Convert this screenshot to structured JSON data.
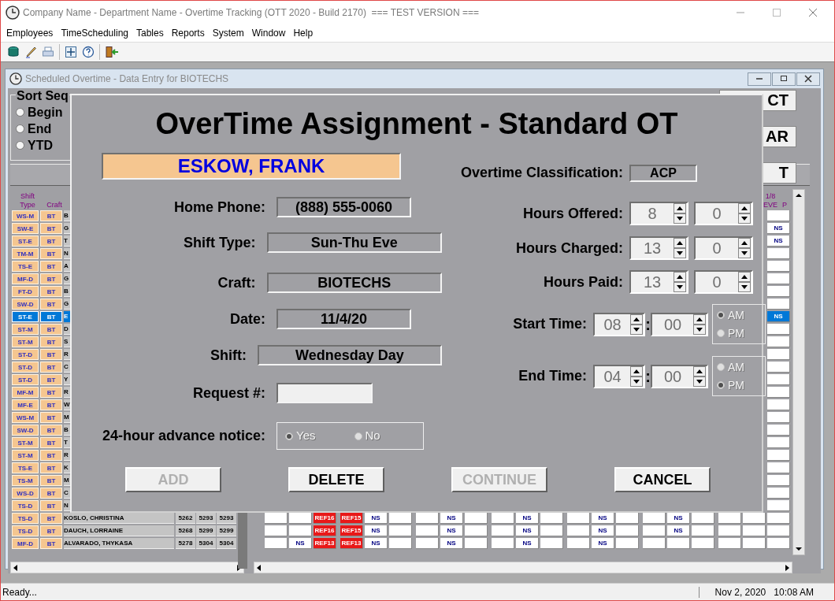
{
  "app_window": {
    "title": "Company Name - Department Name - Overtime Tracking (OTT 2020 - Build 2170)  === TEST VERSION ===",
    "menu": [
      "Employees",
      "TimeScheduling",
      "Tables",
      "Reports",
      "System",
      "Window",
      "Help"
    ]
  },
  "child_window": {
    "title": "Scheduled Overtime - Data Entry for BIOTECHS",
    "sort_group": {
      "label": "Sort Seq",
      "options": [
        {
          "label": "Begin",
          "selected": false
        },
        {
          "label": "End",
          "selected": false
        },
        {
          "label": "YTD",
          "selected": false
        }
      ]
    },
    "side_buttons": [
      "CT",
      "AR",
      "T"
    ],
    "grid": {
      "header_shift_type": "Shift Type",
      "header_craft": "Craft",
      "header_column_21": "1/8 EVE",
      "header_column_22": "P",
      "rows": [
        {
          "shift_type": "WS-M",
          "craft": "BT",
          "name": "B",
          "selected": false,
          "cells": [
            {
              "kind": "blank"
            }
          ]
        },
        {
          "shift_type": "SW-E",
          "craft": "BT",
          "name": "G",
          "selected": false,
          "cells": [
            {
              "kind": "ns",
              "text": "NS"
            }
          ]
        },
        {
          "shift_type": "ST-E",
          "craft": "BT",
          "name": "T",
          "selected": false,
          "cells": [
            {
              "kind": "ns",
              "text": "NS"
            }
          ]
        },
        {
          "shift_type": "TM-M",
          "craft": "BT",
          "name": "N",
          "selected": false,
          "cells": [
            {
              "kind": "blank"
            }
          ]
        },
        {
          "shift_type": "TS-E",
          "craft": "BT",
          "name": "A",
          "selected": false,
          "cells": [
            {
              "kind": "blank"
            }
          ]
        },
        {
          "shift_type": "MF-D",
          "craft": "BT",
          "name": "G",
          "selected": false,
          "cells": [
            {
              "kind": "blank"
            }
          ]
        },
        {
          "shift_type": "FT-D",
          "craft": "BT",
          "name": "B",
          "selected": false,
          "cells": [
            {
              "kind": "blank"
            }
          ]
        },
        {
          "shift_type": "SW-D",
          "craft": "BT",
          "name": "G",
          "selected": false,
          "cells": [
            {
              "kind": "blank"
            }
          ]
        },
        {
          "shift_type": "ST-E",
          "craft": "BT",
          "name": "E",
          "selected": true,
          "cells": [
            {
              "kind": "ns",
              "text": "NS"
            }
          ]
        },
        {
          "shift_type": "ST-M",
          "craft": "BT",
          "name": "D",
          "selected": false,
          "cells": [
            {
              "kind": "blank"
            }
          ]
        },
        {
          "shift_type": "ST-M",
          "craft": "BT",
          "name": "S",
          "selected": false,
          "cells": [
            {
              "kind": "blank"
            }
          ]
        },
        {
          "shift_type": "ST-D",
          "craft": "BT",
          "name": "R",
          "selected": false,
          "cells": [
            {
              "kind": "blank"
            }
          ]
        },
        {
          "shift_type": "ST-D",
          "craft": "BT",
          "name": "C",
          "selected": false,
          "cells": [
            {
              "kind": "blank"
            }
          ]
        },
        {
          "shift_type": "ST-D",
          "craft": "BT",
          "name": "Y",
          "selected": false,
          "cells": [
            {
              "kind": "blank"
            }
          ]
        },
        {
          "shift_type": "MF-M",
          "craft": "BT",
          "name": "R",
          "selected": false,
          "cells": [
            {
              "kind": "blank"
            }
          ]
        },
        {
          "shift_type": "MF-E",
          "craft": "BT",
          "name": "W",
          "selected": false,
          "cells": [
            {
              "kind": "blank"
            }
          ]
        },
        {
          "shift_type": "WS-M",
          "craft": "BT",
          "name": "M",
          "selected": false,
          "cells": [
            {
              "kind": "blank"
            }
          ]
        },
        {
          "shift_type": "SW-D",
          "craft": "BT",
          "name": "B",
          "selected": false,
          "cells": [
            {
              "kind": "blank"
            }
          ]
        },
        {
          "shift_type": "ST-M",
          "craft": "BT",
          "name": "T",
          "selected": false,
          "cells": [
            {
              "kind": "blank"
            }
          ]
        },
        {
          "shift_type": "ST-M",
          "craft": "BT",
          "name": "R",
          "selected": false,
          "cells": [
            {
              "kind": "blank"
            }
          ]
        },
        {
          "shift_type": "TS-E",
          "craft": "BT",
          "name": "K",
          "selected": false,
          "cells": [
            {
              "kind": "blank"
            }
          ]
        },
        {
          "shift_type": "TS-M",
          "craft": "BT",
          "name": "M",
          "selected": false,
          "cells": [
            {
              "kind": "blank"
            }
          ]
        },
        {
          "shift_type": "WS-D",
          "craft": "BT",
          "name": "C",
          "selected": false,
          "cells": [
            {
              "kind": "blank"
            }
          ]
        },
        {
          "shift_type": "TS-D",
          "craft": "BT",
          "name": "N",
          "selected": false,
          "cells": [
            {
              "kind": "blank"
            }
          ]
        },
        {
          "shift_type": "TS-D",
          "craft": "BT",
          "name": "KOSLO, CHRISTINA",
          "numbers": [
            "5262",
            "5293",
            "5293"
          ],
          "selected": false,
          "cells": [
            {
              "kind": "blank"
            },
            {
              "kind": "blank"
            },
            {
              "kind": "ref",
              "text": "REF16"
            },
            {
              "kind": "ref",
              "text": "REF15"
            },
            {
              "kind": "ns",
              "text": "NS"
            },
            {
              "kind": "blank"
            },
            {
              "kind": "blank"
            },
            {
              "kind": "ns",
              "text": "NS"
            },
            {
              "kind": "blank"
            },
            {
              "kind": "blank"
            },
            {
              "kind": "ns",
              "text": "NS"
            },
            {
              "kind": "blank"
            },
            {
              "kind": "blank"
            },
            {
              "kind": "ns",
              "text": "NS"
            },
            {
              "kind": "blank"
            },
            {
              "kind": "blank"
            },
            {
              "kind": "ns",
              "text": "NS"
            },
            {
              "kind": "blank"
            },
            {
              "kind": "blank"
            },
            {
              "kind": "blank"
            },
            {
              "kind": "blank"
            }
          ]
        },
        {
          "shift_type": "TS-D",
          "craft": "BT",
          "name": "DAUCH, LORRAINE",
          "numbers": [
            "5268",
            "5299",
            "5299"
          ],
          "selected": false,
          "cells": [
            {
              "kind": "blank"
            },
            {
              "kind": "blank"
            },
            {
              "kind": "ref",
              "text": "REF16"
            },
            {
              "kind": "ref",
              "text": "REF15"
            },
            {
              "kind": "ns",
              "text": "NS"
            },
            {
              "kind": "blank"
            },
            {
              "kind": "blank"
            },
            {
              "kind": "ns",
              "text": "NS"
            },
            {
              "kind": "blank"
            },
            {
              "kind": "blank"
            },
            {
              "kind": "ns",
              "text": "NS"
            },
            {
              "kind": "blank"
            },
            {
              "kind": "blank"
            },
            {
              "kind": "ns",
              "text": "NS"
            },
            {
              "kind": "blank"
            },
            {
              "kind": "blank"
            },
            {
              "kind": "ns",
              "text": "NS"
            },
            {
              "kind": "blank"
            },
            {
              "kind": "blank"
            },
            {
              "kind": "blank"
            },
            {
              "kind": "blank"
            }
          ]
        },
        {
          "shift_type": "MF-D",
          "craft": "BT",
          "name": "ALVARADO, THYKASA",
          "numbers": [
            "5278",
            "5304",
            "5304"
          ],
          "selected": false,
          "cells": [
            {
              "kind": "blank"
            },
            {
              "kind": "ns",
              "text": "NS"
            },
            {
              "kind": "ref",
              "text": "REF13"
            },
            {
              "kind": "ref",
              "text": "REF13"
            },
            {
              "kind": "ns",
              "text": "NS"
            },
            {
              "kind": "blank"
            },
            {
              "kind": "blank"
            },
            {
              "kind": "ns",
              "text": "NS"
            },
            {
              "kind": "blank"
            },
            {
              "kind": "blank"
            },
            {
              "kind": "ns",
              "text": "NS"
            },
            {
              "kind": "blank"
            },
            {
              "kind": "blank"
            },
            {
              "kind": "ns",
              "text": "NS"
            },
            {
              "kind": "blank"
            },
            {
              "kind": "blank"
            },
            {
              "kind": "blank"
            },
            {
              "kind": "blank"
            },
            {
              "kind": "blank"
            },
            {
              "kind": "blank"
            },
            {
              "kind": "blank"
            }
          ]
        }
      ]
    }
  },
  "dialog": {
    "title": "OverTime Assignment - Standard OT",
    "employee": "ESKOW, FRANK",
    "fields": [
      {
        "label": "Home Phone:",
        "value": "(888) 555-0060",
        "kind": "short"
      },
      {
        "label": "Shift Type:",
        "value": "Sun-Thu Eve",
        "kind": "wide"
      },
      {
        "label": "Craft:",
        "value": "BIOTECHS",
        "kind": "wide"
      },
      {
        "label": "Date:",
        "value": "11/4/20",
        "kind": "short"
      },
      {
        "label": "Shift:",
        "value": "Wednesday Day",
        "kind": "widest"
      },
      {
        "label": "Request #:",
        "kind": "input"
      }
    ],
    "advance_notice": {
      "label": "24-hour advance notice:",
      "disabled": true,
      "options": [
        {
          "label": "Yes",
          "selected": true
        },
        {
          "label": "No",
          "selected": false
        }
      ]
    },
    "classification": {
      "label": "Overtime Classification:",
      "value": "ACP"
    },
    "hours": [
      {
        "label": "Hours Offered:",
        "hours": "8",
        "minutes": "0"
      },
      {
        "label": "Hours Charged:",
        "hours": "13",
        "minutes": "0"
      },
      {
        "label": "Hours Paid:",
        "hours": "13",
        "minutes": "0"
      }
    ],
    "times": [
      {
        "label": "Start Time:",
        "hour": "08",
        "separator": ":",
        "minute": "00",
        "options": [
          {
            "label": "AM",
            "selected": true
          },
          {
            "label": "PM",
            "selected": false
          }
        ]
      },
      {
        "label": "End Time:",
        "hour": "04",
        "separator": ":",
        "minute": "00",
        "options": [
          {
            "label": "AM",
            "selected": false
          },
          {
            "label": "PM",
            "selected": true
          }
        ]
      }
    ],
    "buttons": [
      {
        "label": "ADD",
        "disabled": true
      },
      {
        "label": "DELETE",
        "disabled": false
      },
      {
        "label": "CONTINUE",
        "disabled": true
      },
      {
        "label": "CANCEL",
        "disabled": false
      }
    ]
  },
  "status_bar": {
    "message": "Ready...",
    "date": "Nov 2, 2020",
    "time": "10:08 AM"
  }
}
